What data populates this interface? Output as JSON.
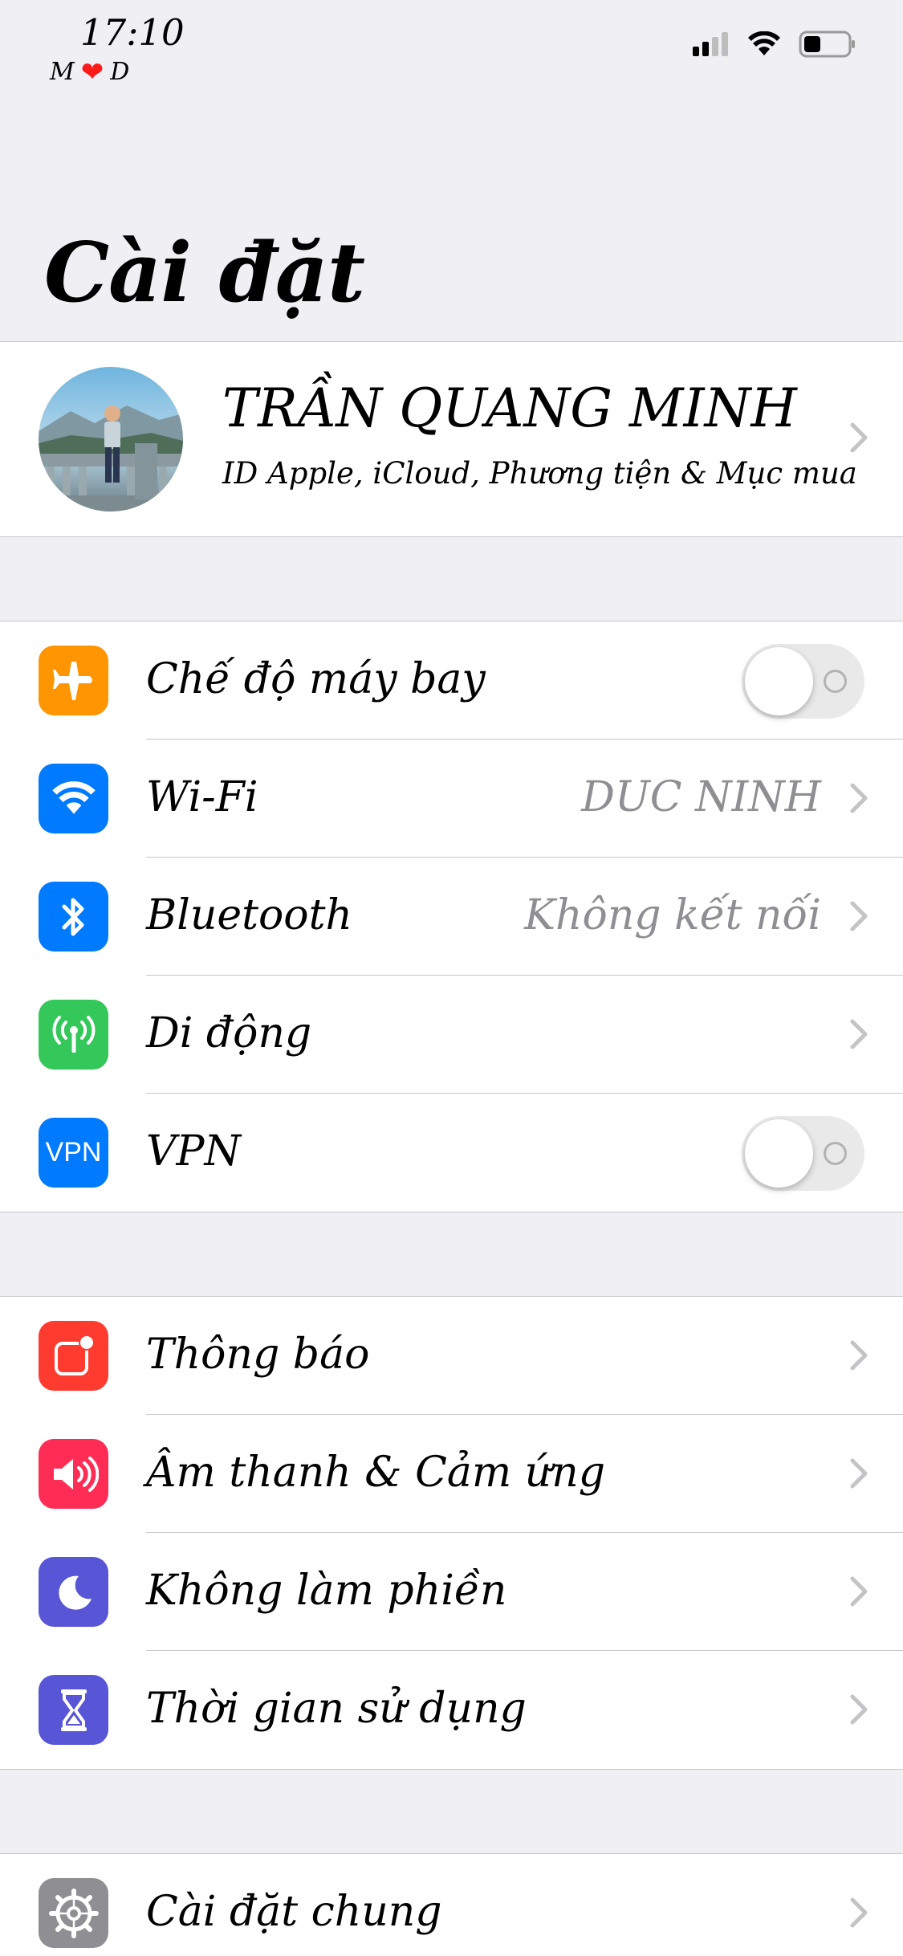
{
  "status_bar": {
    "time": "17:10",
    "left_letter": "M",
    "right_letter": "D"
  },
  "title": "Cài đặt",
  "profile": {
    "name": "TRẦN QUANG MINH",
    "subtitle": "ID Apple, iCloud, Phương tiện & Mục mua"
  },
  "connectivity": {
    "airplane": {
      "label": "Chế độ máy bay",
      "enabled": false,
      "icon": "airplane-icon",
      "color": "#ff9500"
    },
    "wifi": {
      "label": "Wi-Fi",
      "value": "DUC NINH",
      "icon": "wifi-icon",
      "color": "#007aff"
    },
    "bluetooth": {
      "label": "Bluetooth",
      "value": "Không kết nối",
      "icon": "bluetooth-icon",
      "color": "#007aff"
    },
    "cellular": {
      "label": "Di động",
      "icon": "cellular-antenna-icon",
      "color": "#34c759"
    },
    "vpn": {
      "label": "VPN",
      "icon_text": "VPN",
      "enabled": false,
      "color": "#007aff"
    }
  },
  "notifications_group": {
    "notifications": {
      "label": "Thông báo",
      "icon": "notifications-icon",
      "color": "#ff3b30"
    },
    "sounds": {
      "label": "Âm thanh & Cảm ứng",
      "icon": "speaker-icon",
      "color": "#ff2d55"
    },
    "dnd": {
      "label": "Không làm phiền",
      "icon": "moon-icon",
      "color": "#5856d6"
    },
    "screen_time": {
      "label": "Thời gian sử dụng",
      "icon": "hourglass-icon",
      "color": "#5856d6"
    }
  },
  "general_group": {
    "general": {
      "label": "Cài đặt chung",
      "icon": "gear-icon",
      "color": "#8e8e93"
    }
  }
}
